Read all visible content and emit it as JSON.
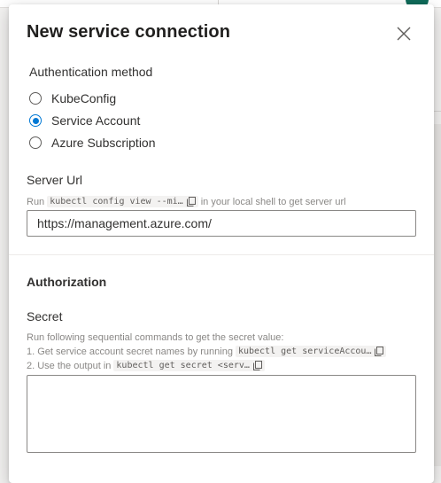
{
  "dialog": {
    "title": "New service connection"
  },
  "auth_method": {
    "label": "Authentication method",
    "options": [
      {
        "label": "KubeConfig",
        "checked": false
      },
      {
        "label": "Service Account",
        "checked": true
      },
      {
        "label": "Azure Subscription",
        "checked": false
      }
    ]
  },
  "server_url": {
    "label": "Server Url",
    "help_prefix": "Run",
    "help_code": "kubectl config view --mi…",
    "help_suffix": "in your local shell to get server url",
    "value": "https://management.azure.com/"
  },
  "authorization": {
    "heading": "Authorization"
  },
  "secret": {
    "label": "Secret",
    "help_intro": "Run following sequential commands to get the secret value:",
    "step1_text": "1. Get service account secret names by running",
    "step1_code": "kubectl get serviceAccou…",
    "step2_text": "2. Use the output in",
    "step2_code": "kubectl get secret <serv…",
    "value": ""
  },
  "icons": {
    "close": "close-icon",
    "copy": "copy-icon"
  },
  "colors": {
    "accent": "#0078d4",
    "text": "#323130",
    "helper": "#8a8886"
  }
}
